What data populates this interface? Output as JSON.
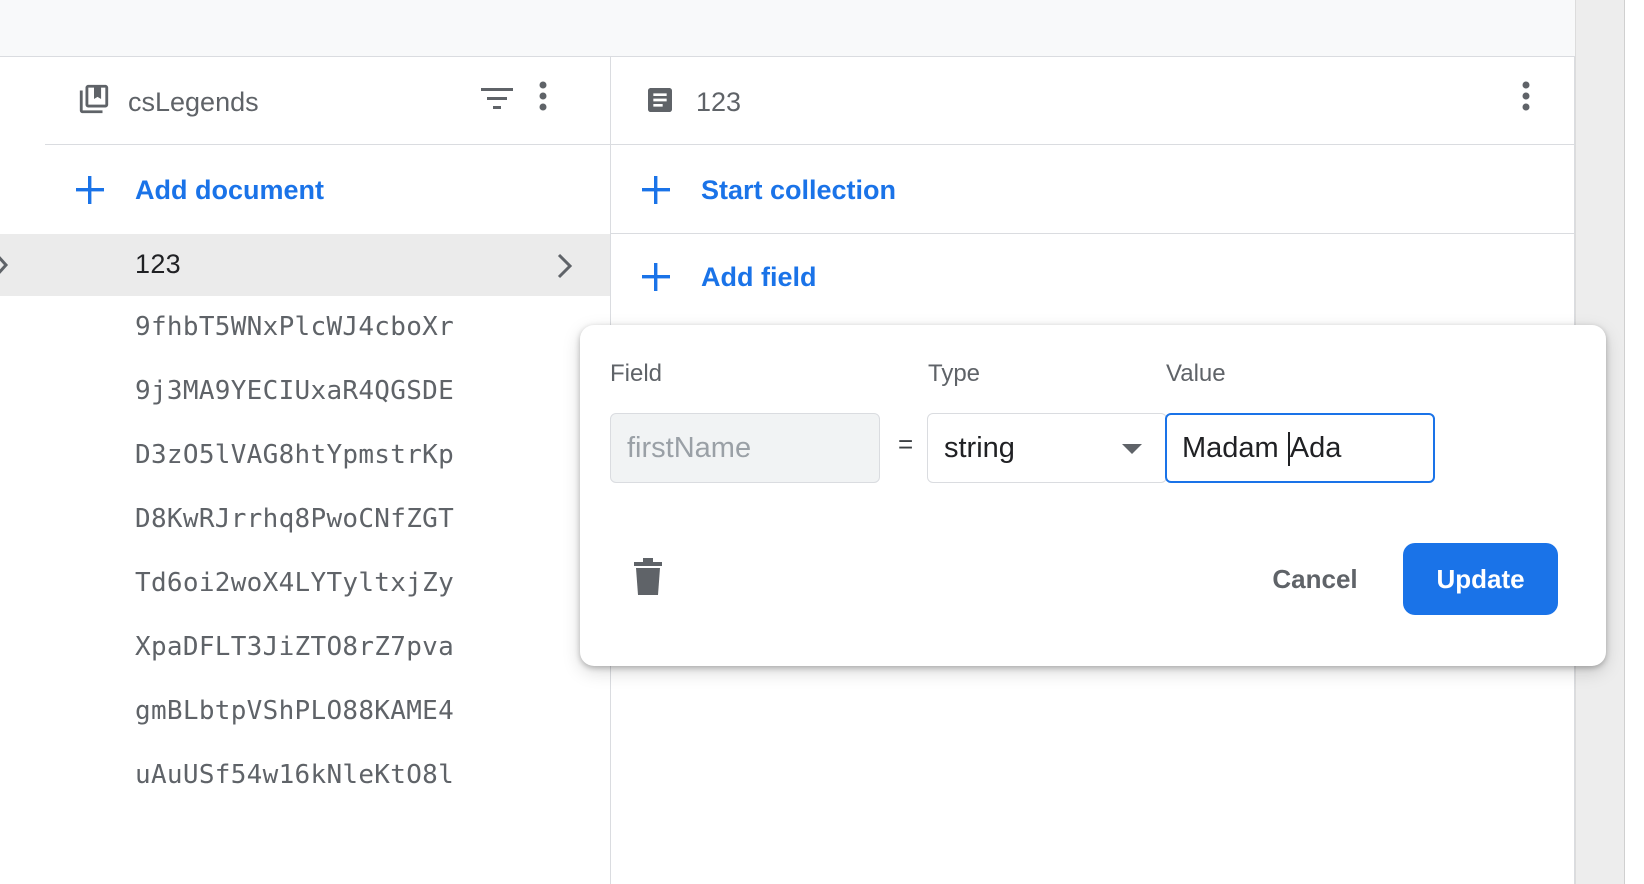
{
  "collection": {
    "name": "csLegends",
    "add_document_label": "Add document",
    "documents": [
      "123",
      "9fhbT5WNxPlcWJ4cboXr",
      "9j3MA9YECIUxaR4QGSDE",
      "D3zO5lVAG8htYpmstrKp",
      "D8KwRJrrhq8PwoCNfZGT",
      "Td6oi2woX4LYTyltxjZy",
      "XpaDFLT3JiZTO8rZ7pva",
      "gmBLbtpVShPLO88KAME4",
      "uAuUSf54w16kNleKtO8l"
    ],
    "selected_document": "123"
  },
  "document": {
    "name": "123",
    "start_collection_label": "Start collection",
    "add_field_label": "Add field"
  },
  "edit_dialog": {
    "field_label": "Field",
    "type_label": "Type",
    "value_label": "Value",
    "field_value": "firstName",
    "equals": "=",
    "type_value": "string",
    "value_before_cursor": "Madam ",
    "value_after_cursor": "Ada",
    "cancel_label": "Cancel",
    "update_label": "Update"
  },
  "colors": {
    "accent": "#1a73e8",
    "selected_row": "#ebebeb"
  },
  "icons": {
    "collection": "collection-icon",
    "filter": "filter-icon",
    "more": "more-vert-icon",
    "document": "document-icon",
    "add": "plus-icon",
    "chevron": "chevron-right-icon",
    "delete": "trash-icon",
    "dropdown": "dropdown-caret-icon"
  }
}
